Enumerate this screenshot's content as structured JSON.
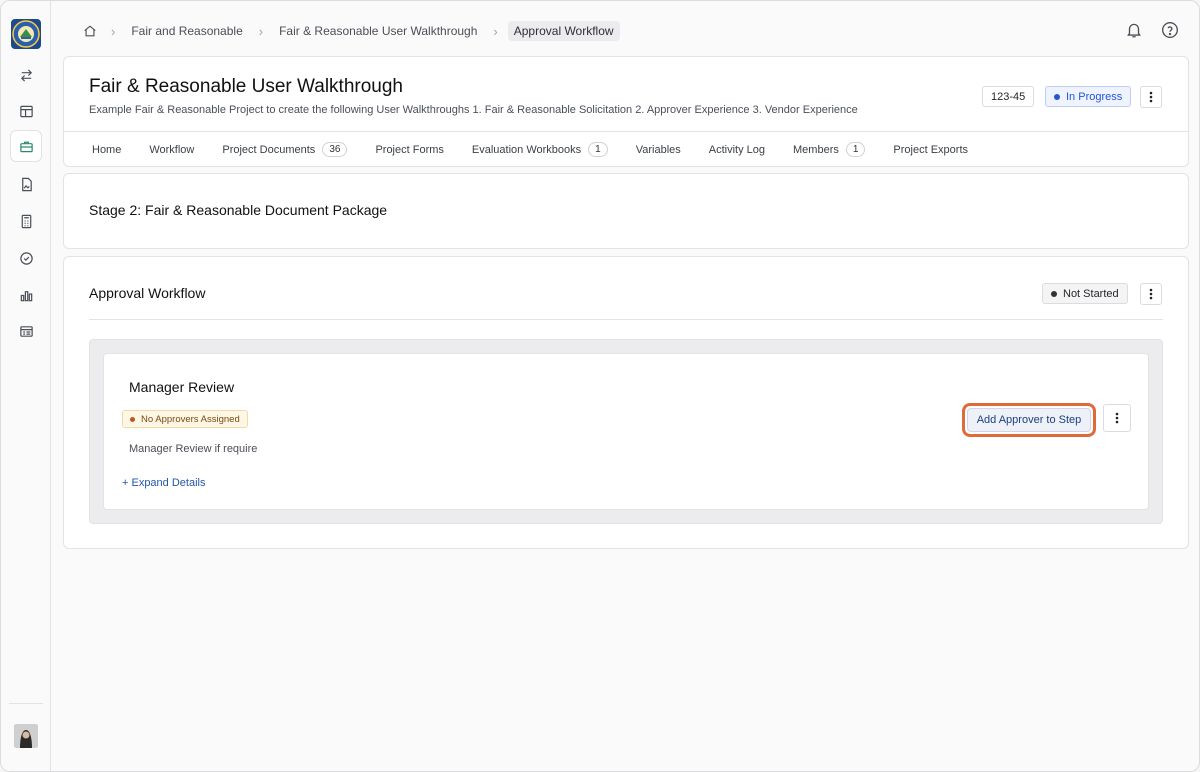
{
  "sidebar": {
    "items": [
      {
        "icon": "swap-icon"
      },
      {
        "icon": "layout-icon"
      },
      {
        "icon": "briefcase-icon",
        "active": true
      },
      {
        "icon": "document-image-icon"
      },
      {
        "icon": "calculator-icon"
      },
      {
        "icon": "check-circle-icon"
      },
      {
        "icon": "bar-chart-icon"
      },
      {
        "icon": "list-card-icon"
      }
    ]
  },
  "breadcrumb": {
    "items": [
      "Fair and Reasonable",
      "Fair & Reasonable User Walkthrough"
    ],
    "current": "Approval Workflow"
  },
  "project": {
    "title": "Fair & Reasonable User Walkthrough",
    "description": "Example Fair & Reasonable Project to create the following User Walkthroughs 1. Fair & Reasonable Solicitation 2. Approver Experience 3. Vendor Experience",
    "number": "123-45",
    "status": "In Progress",
    "status_color": "#2456d6"
  },
  "tabs": [
    {
      "label": "Home",
      "count": ""
    },
    {
      "label": "Workflow",
      "count": ""
    },
    {
      "label": "Project Documents",
      "count": "36"
    },
    {
      "label": "Project Forms",
      "count": ""
    },
    {
      "label": "Evaluation Workbooks",
      "count": "1"
    },
    {
      "label": "Variables",
      "count": ""
    },
    {
      "label": "Activity Log",
      "count": ""
    },
    {
      "label": "Members",
      "count": "1"
    },
    {
      "label": "Project Exports",
      "count": ""
    }
  ],
  "stage": {
    "title": "Stage 2: Fair & Reasonable Document Package"
  },
  "workflow": {
    "title": "Approval Workflow",
    "status": "Not Started",
    "status_color": "#333333"
  },
  "step": {
    "name": "Manager Review",
    "badge": "No Approvers Assigned",
    "badge_color": "#c0571b",
    "description": "Manager Review if require",
    "expand_link": "+ Expand Details",
    "add_button": "Add Approver to Step"
  }
}
